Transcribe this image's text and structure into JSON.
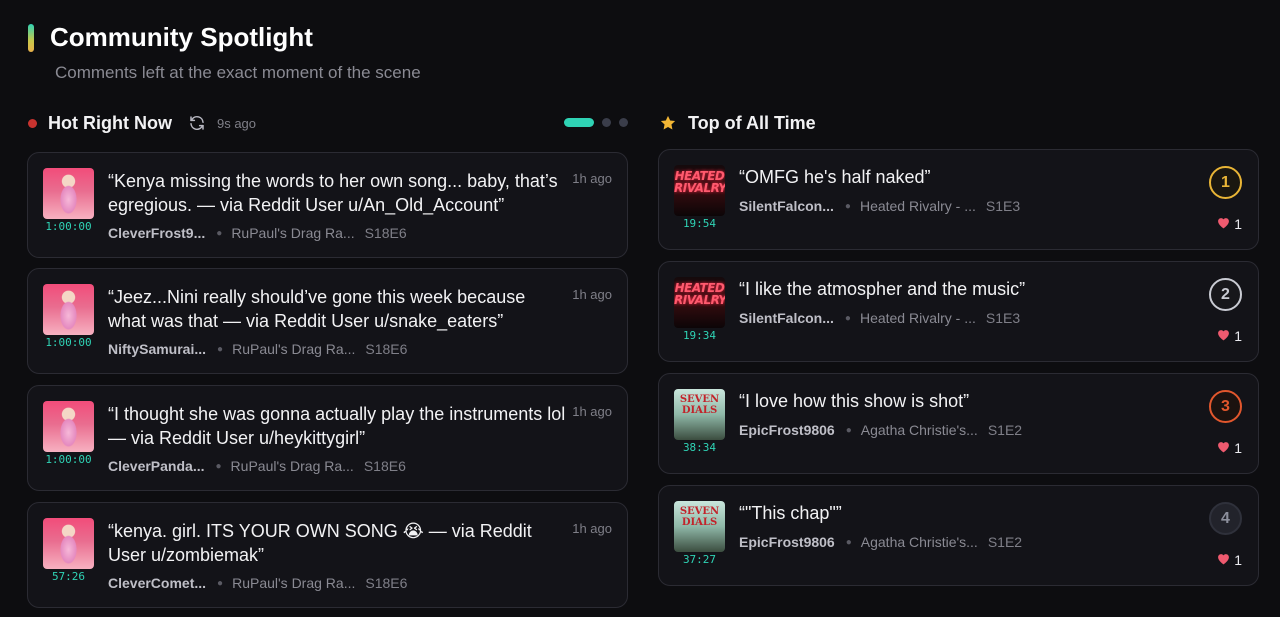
{
  "page": {
    "title": "Community Spotlight",
    "subtitle": "Comments left at the exact moment of the scene"
  },
  "colors": {
    "accent": "#2fd3b5",
    "live": "#c8332f",
    "star": "#f2b635",
    "heart": "#ef5a6f",
    "rank1": "#e9b536",
    "rank2": "#c9cbd3",
    "rank3": "#e2572d",
    "rank4": "#8c8f9c"
  },
  "hot": {
    "title": "Hot Right Now",
    "updated": "9s ago",
    "refresh_icon": "refresh-icon",
    "items": [
      {
        "quote": "“Kenya missing the words to her own song... baby, that’s egregious. — via Reddit User u/An_Old_Account”",
        "user": "CleverFrost9...",
        "show": "RuPaul's Drag Ra...",
        "episode": "S18E6",
        "timecode": "1:00:00",
        "age": "1h ago"
      },
      {
        "quote": "“Jeez...Nini really should’ve gone this week because what was that — via Reddit User u/snake_eaters”",
        "user": "NiftySamurai...",
        "show": "RuPaul's Drag Ra...",
        "episode": "S18E6",
        "timecode": "1:00:00",
        "age": "1h ago"
      },
      {
        "quote": "“I thought she was gonna actually play the instruments lol — via Reddit User u/heykittygirl”",
        "user": "CleverPanda...",
        "show": "RuPaul's Drag Ra...",
        "episode": "S18E6",
        "timecode": "1:00:00",
        "age": "1h ago"
      },
      {
        "quote": "“kenya. girl. ITS YOUR OWN SONG 😭 — via Reddit User u/zombiemak”",
        "user": "CleverComet...",
        "show": "RuPaul's Drag Ra...",
        "episode": "S18E6",
        "timecode": "57:26",
        "age": "1h ago"
      }
    ]
  },
  "top": {
    "title": "Top of All Time",
    "star_icon": "star-icon",
    "items": [
      {
        "rank": "1",
        "quote": "“OMFG he's half naked”",
        "user": "SilentFalcon...",
        "show": "Heated Rivalry - ...",
        "episode": "S1E3",
        "timecode": "19:54",
        "poster_text": "HEATED RIVALRY",
        "likes": "1"
      },
      {
        "rank": "2",
        "quote": "“I like the atmospher and the music”",
        "user": "SilentFalcon...",
        "show": "Heated Rivalry - ...",
        "episode": "S1E3",
        "timecode": "19:34",
        "poster_text": "HEATED RIVALRY",
        "likes": "1"
      },
      {
        "rank": "3",
        "quote": "“I love how this show is shot”",
        "user": "EpicFrost9806",
        "show": "Agatha Christie's...",
        "episode": "S1E2",
        "timecode": "38:34",
        "poster_text": "SEVEN DIALS",
        "likes": "1"
      },
      {
        "rank": "4",
        "quote": "“\"This chap\"”",
        "user": "EpicFrost9806",
        "show": "Agatha Christie's...",
        "episode": "S1E2",
        "timecode": "37:27",
        "poster_text": "SEVEN DIALS",
        "likes": "1"
      }
    ]
  }
}
